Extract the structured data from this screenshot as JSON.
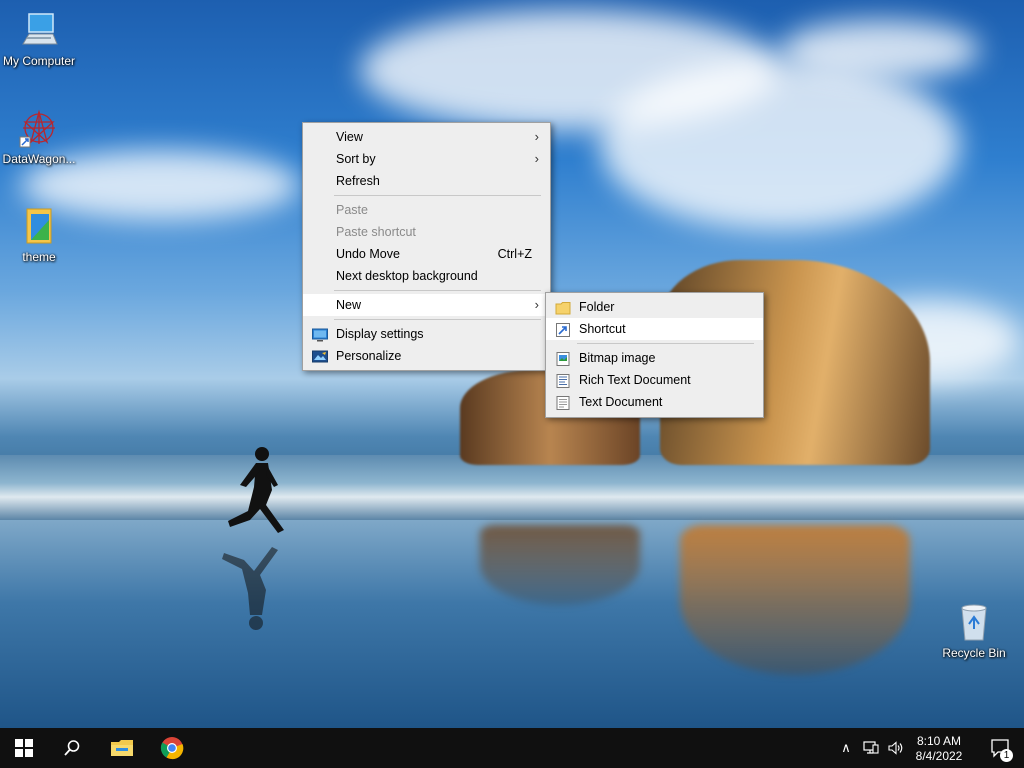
{
  "desktop": {
    "icons": [
      {
        "label": "My Computer",
        "icon": "computer-icon"
      },
      {
        "label": "DataWagon...",
        "icon": "app-icon"
      },
      {
        "label": "theme",
        "icon": "folder-file-icon"
      },
      {
        "label": "Recycle Bin",
        "icon": "recycle-bin-icon"
      }
    ]
  },
  "context_menu": {
    "view": "View",
    "sort_by": "Sort by",
    "refresh": "Refresh",
    "paste": "Paste",
    "paste_shortcut": "Paste shortcut",
    "undo_move": "Undo Move",
    "undo_shortcut": "Ctrl+Z",
    "next_background": "Next desktop background",
    "new": "New",
    "display_settings": "Display settings",
    "personalize": "Personalize"
  },
  "new_submenu": {
    "folder": "Folder",
    "shortcut": "Shortcut",
    "bitmap": "Bitmap image",
    "rich_text": "Rich Text Document",
    "text_document": "Text Document"
  },
  "taskbar": {
    "clock_time": "8:10 AM",
    "clock_date": "8/4/2022",
    "notification_count": "1"
  },
  "colors": {
    "taskbar": "#101010",
    "menu_bg": "#eeeeee",
    "highlight": "#ffffff",
    "disabled_text": "#8a8a8a"
  }
}
